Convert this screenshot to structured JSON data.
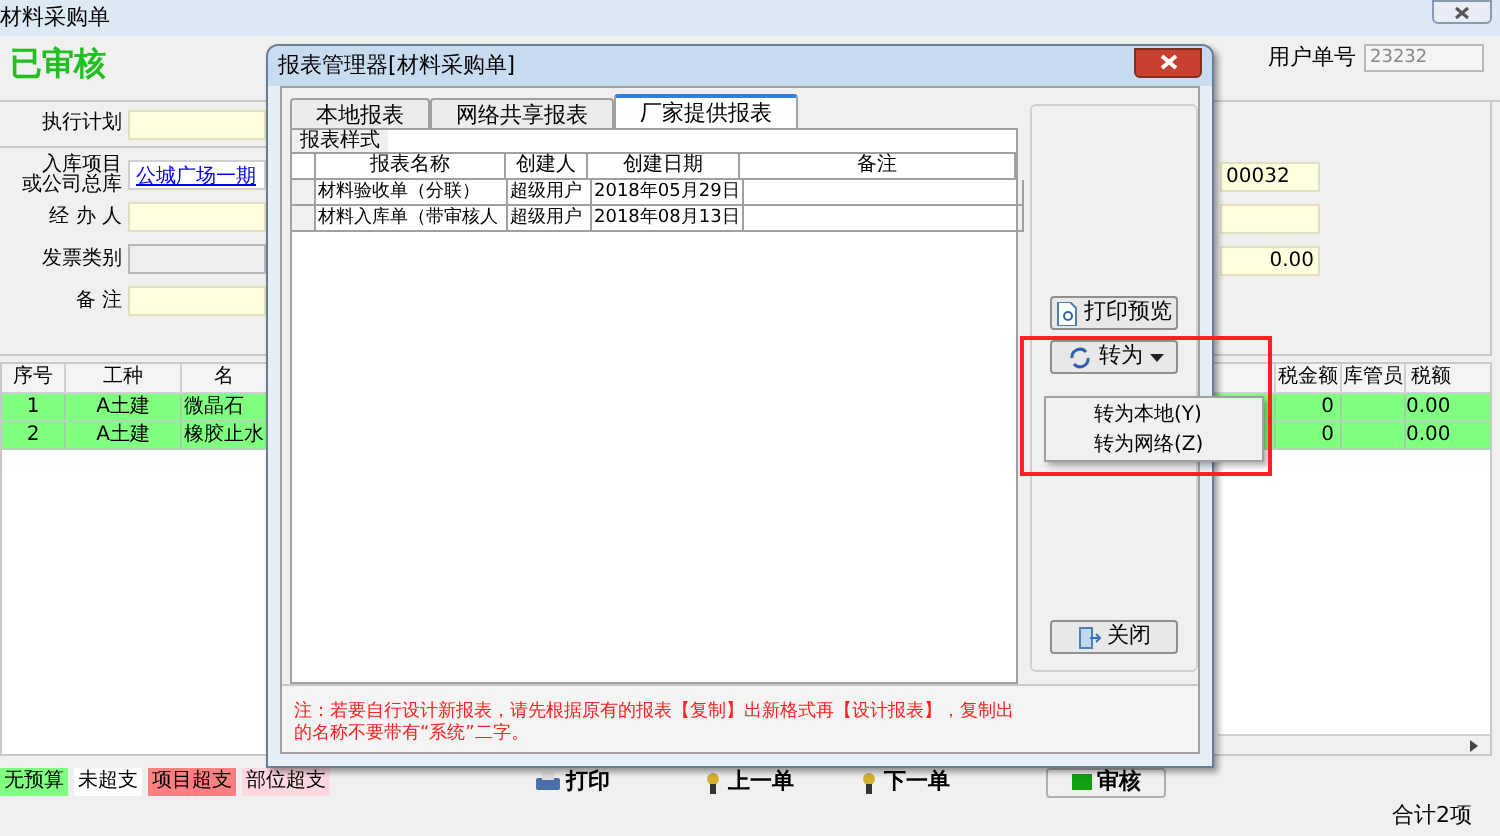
{
  "window": {
    "title": "材料采购单",
    "status": "已审核",
    "user_no_label": "用户单号",
    "user_no": "23232"
  },
  "form": [
    {
      "label": "执行计划",
      "kind": "input"
    },
    {
      "label": "入库项目",
      "label_2": "或公司总库",
      "kind": "link",
      "value": "公城广场一期"
    },
    {
      "label": "经 办 人",
      "kind": "input"
    },
    {
      "label": "发票类别",
      "kind": "readonly"
    },
    {
      "label": "备 注",
      "kind": "input"
    }
  ],
  "right_fields": [
    {
      "kind": "text",
      "value": "00032"
    },
    {
      "kind": "text"
    },
    {
      "kind": "number",
      "value": "0.00"
    }
  ],
  "table": {
    "columns_left": [
      "序号",
      "工种",
      "名"
    ],
    "columns_right": [
      "税金额",
      "库管员",
      "税额"
    ],
    "rows": [
      {
        "no": "1",
        "trade": "A土建",
        "name": "微晶石",
        "amount": "0",
        "tax": "0.00"
      },
      {
        "no": "2",
        "trade": "A土建",
        "name": "橡胶止水",
        "amount": "0",
        "tax": "0.00"
      }
    ]
  },
  "legend": [
    {
      "label": "无预算",
      "color": "#80ff80"
    },
    {
      "label": "未超支",
      "color": "#ffffff"
    },
    {
      "label": "项目超支",
      "color": "#ff8080"
    },
    {
      "label": "部位超支",
      "color": "#ffd8e0"
    }
  ],
  "toolbar": [
    {
      "kind": "print",
      "label": "打印"
    },
    {
      "kind": "prev",
      "label": "上一单"
    },
    {
      "kind": "next",
      "label": "下一单"
    },
    {
      "kind": "approve",
      "label": "审核"
    }
  ],
  "status_bar": "合计2项",
  "dialog": {
    "title": "报表管理器[材料采购单]",
    "tabs": [
      {
        "label": "本地报表",
        "selected": false
      },
      {
        "label": "网络共享报表",
        "selected": false
      },
      {
        "label": "厂家提供报表",
        "selected": true
      }
    ],
    "group": "报表样式",
    "columns": [
      "报表名称",
      "创建人",
      "创建日期",
      "备注"
    ],
    "rows": [
      {
        "name": "材料验收单（分联）",
        "creator": "超级用户",
        "date": "2018年05月29日"
      },
      {
        "name": "材料入库单（带审核人",
        "creator": "超级用户",
        "date": "2018年08月13日"
      }
    ],
    "print_preview": "打印预览",
    "convert": "转为",
    "close": "关闭",
    "menu": [
      "转为本地(Y)",
      "转为网络(Z)"
    ],
    "note": "注：若要自行设计新报表，请先根据原有的报表【复制】出新格式再【设计报表】，复制出的名称不要带有“系统”二字。"
  }
}
